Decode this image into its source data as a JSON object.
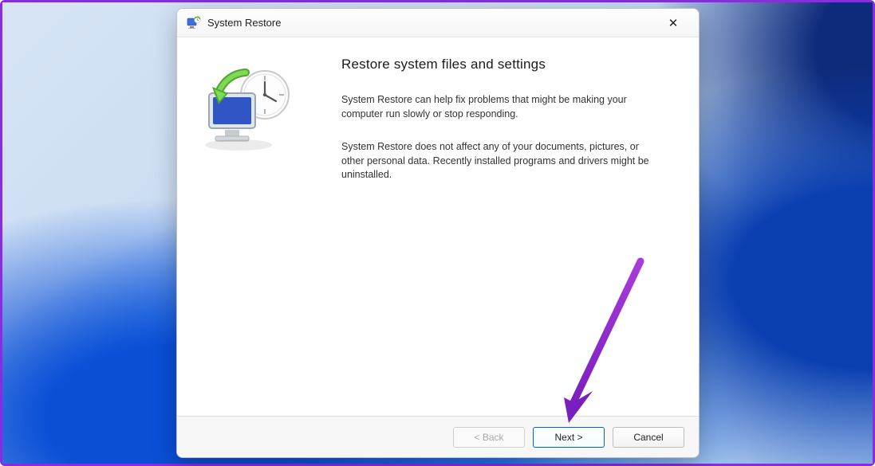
{
  "titlebar": {
    "title": "System Restore",
    "close_glyph": "✕"
  },
  "content": {
    "heading": "Restore system files and settings",
    "p1": "System Restore can help fix problems that might be making your computer run slowly or stop responding.",
    "p2": "System Restore does not affect any of your documents, pictures, or other personal data. Recently installed programs and drivers might be uninstalled."
  },
  "footer": {
    "back": "< Back",
    "next": "Next >",
    "cancel": "Cancel"
  }
}
